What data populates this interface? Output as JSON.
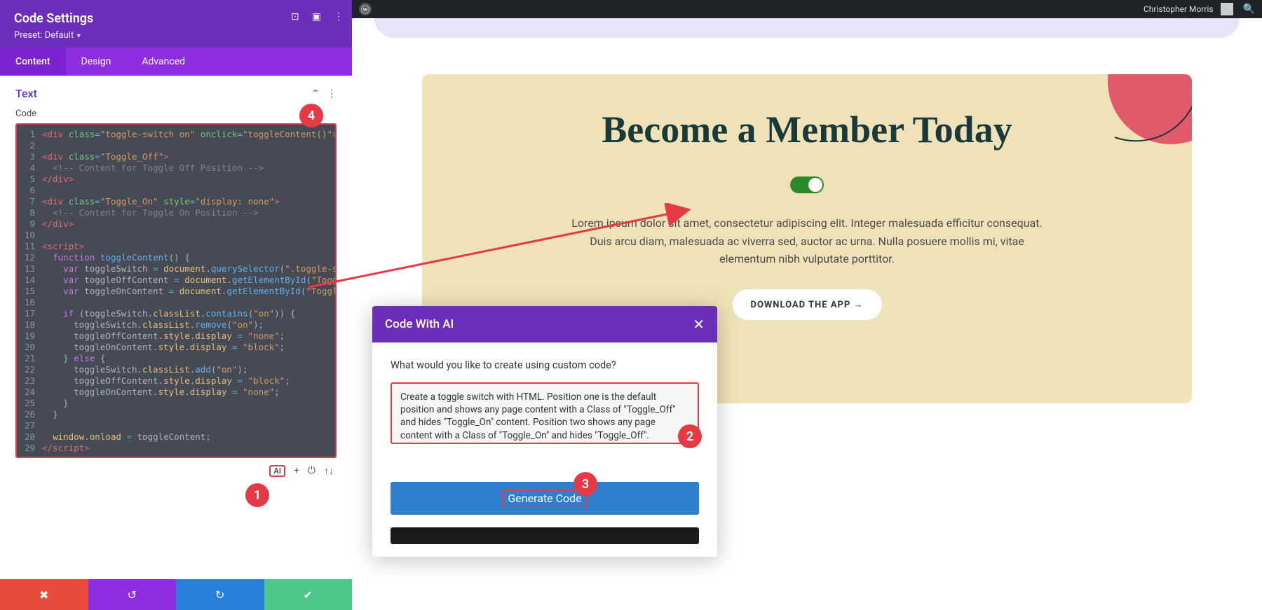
{
  "panel": {
    "title": "Code Settings",
    "preset_prefix": "Preset: ",
    "preset_value": "Default",
    "header_icons": {
      "drag": "drag-icon",
      "responsive": "responsive-icon",
      "more": "more-icon"
    },
    "tabs": [
      {
        "label": "Content",
        "active": true
      },
      {
        "label": "Design",
        "active": false
      },
      {
        "label": "Advanced",
        "active": false
      }
    ],
    "section": {
      "title": "Text",
      "code_label": "Code"
    },
    "editor_tools": {
      "ai": "AI",
      "add": "+",
      "reset": "⟳",
      "expand": "↑↓"
    }
  },
  "code": {
    "lines": [
      {
        "n": 1,
        "html": "<span class='t-tag'>&lt;div</span> <span class='t-attr'>class</span><span class='t-op'>=</span><span class='t-str'>\"toggle-switch on\"</span> <span class='t-attr'>onclick</span><span class='t-op'>=</span><span class='t-str'>\"toggleContent()\"</span><span class='t-tag'>&gt;&lt;/div&gt;</span>"
      },
      {
        "n": 2,
        "html": ""
      },
      {
        "n": 3,
        "html": "<span class='t-tag'>&lt;div</span> <span class='t-attr'>class</span><span class='t-op'>=</span><span class='t-str'>\"Toggle_Off\"</span><span class='t-tag'>&gt;</span>"
      },
      {
        "n": 4,
        "html": "  <span class='t-cm'>&lt;!-- Content for Toggle Off Position --&gt;</span>"
      },
      {
        "n": 5,
        "html": "<span class='t-tag'>&lt;/div&gt;</span>"
      },
      {
        "n": 6,
        "html": ""
      },
      {
        "n": 7,
        "html": "<span class='t-tag'>&lt;div</span> <span class='t-attr'>class</span><span class='t-op'>=</span><span class='t-str'>\"Toggle_On\"</span> <span class='t-attr'>style</span><span class='t-op'>=</span><span class='t-str'>\"display: none\"</span><span class='t-tag'>&gt;</span>"
      },
      {
        "n": 8,
        "html": "  <span class='t-cm'>&lt;!-- Content for Toggle On Position --&gt;</span>"
      },
      {
        "n": 9,
        "html": "<span class='t-tag'>&lt;/div&gt;</span>"
      },
      {
        "n": 10,
        "html": ""
      },
      {
        "n": 11,
        "html": "<span class='t-tag'>&lt;script&gt;</span>"
      },
      {
        "n": 12,
        "html": "  <span class='t-kw'>function</span> <span class='t-fn'>toggleContent</span><span class='t-pl'>() {</span>"
      },
      {
        "n": 13,
        "html": "    <span class='t-kw'>var</span> <span class='t-pl'>toggleSwitch</span> <span class='t-op'>=</span> <span class='t-id'>document</span><span class='t-dot'>.</span><span class='t-fn'>querySelector</span><span class='t-pl'>(</span><span class='t-str'>\".toggle-switch\"</span><span class='t-pl'>);</span>"
      },
      {
        "n": 14,
        "html": "    <span class='t-kw'>var</span> <span class='t-pl'>toggleOffContent</span> <span class='t-op'>=</span> <span class='t-id'>document</span><span class='t-dot'>.</span><span class='t-fn'>getElementById</span><span class='t-pl'>(</span><span class='t-str'>\"Toggle_Off\"</span><span class='t-pl'>);</span>"
      },
      {
        "n": 15,
        "html": "    <span class='t-kw'>var</span> <span class='t-pl'>toggleOnContent</span> <span class='t-op'>=</span> <span class='t-id'>document</span><span class='t-dot'>.</span><span class='t-fn'>getElementById</span><span class='t-pl'>(</span><span class='t-str'>\"Toggle_On\"</span><span class='t-pl'>);</span>"
      },
      {
        "n": 16,
        "html": ""
      },
      {
        "n": 17,
        "html": "    <span class='t-kw'>if</span> <span class='t-pl'>(toggleSwitch</span><span class='t-dot'>.</span><span class='t-id'>classList</span><span class='t-dot'>.</span><span class='t-fn'>contains</span><span class='t-pl'>(</span><span class='t-str'>\"on\"</span><span class='t-pl'>)) {</span>"
      },
      {
        "n": 18,
        "html": "      <span class='t-pl'>toggleSwitch</span><span class='t-dot'>.</span><span class='t-id'>classList</span><span class='t-dot'>.</span><span class='t-fn'>remove</span><span class='t-pl'>(</span><span class='t-str'>\"on\"</span><span class='t-pl'>);</span>"
      },
      {
        "n": 19,
        "html": "      <span class='t-pl'>toggleOffContent</span><span class='t-dot'>.</span><span class='t-id'>style</span><span class='t-dot'>.</span><span class='t-id'>display</span> <span class='t-op'>=</span> <span class='t-str'>\"none\"</span><span class='t-pl'>;</span>"
      },
      {
        "n": 20,
        "html": "      <span class='t-pl'>toggleOnContent</span><span class='t-dot'>.</span><span class='t-id'>style</span><span class='t-dot'>.</span><span class='t-id'>display</span> <span class='t-op'>=</span> <span class='t-str'>\"block\"</span><span class='t-pl'>;</span>"
      },
      {
        "n": 21,
        "html": "    <span class='t-pl'>}</span> <span class='t-kw'>else</span> <span class='t-pl'>{</span>"
      },
      {
        "n": 22,
        "html": "      <span class='t-pl'>toggleSwitch</span><span class='t-dot'>.</span><span class='t-id'>classList</span><span class='t-dot'>.</span><span class='t-fn'>add</span><span class='t-pl'>(</span><span class='t-str'>\"on\"</span><span class='t-pl'>);</span>"
      },
      {
        "n": 23,
        "html": "      <span class='t-pl'>toggleOffContent</span><span class='t-dot'>.</span><span class='t-id'>style</span><span class='t-dot'>.</span><span class='t-id'>display</span> <span class='t-op'>=</span> <span class='t-str'>\"block\"</span><span class='t-pl'>;</span>"
      },
      {
        "n": 24,
        "html": "      <span class='t-pl'>toggleOnContent</span><span class='t-dot'>.</span><span class='t-id'>style</span><span class='t-dot'>.</span><span class='t-id'>display</span> <span class='t-op'>=</span> <span class='t-str'>\"none\"</span><span class='t-pl'>;</span>"
      },
      {
        "n": 25,
        "html": "    <span class='t-pl'>}</span>"
      },
      {
        "n": 26,
        "html": "  <span class='t-pl'>}</span>"
      },
      {
        "n": 27,
        "html": ""
      },
      {
        "n": 28,
        "html": "  <span class='t-id'>window</span><span class='t-dot'>.</span><span class='t-id'>onload</span> <span class='t-op'>=</span> <span class='t-pl'>toggleContent;</span>"
      },
      {
        "n": 29,
        "html": "<span class='t-tag'>&lt;/script&gt;</span>"
      }
    ]
  },
  "wp": {
    "user": "Christopher Morris"
  },
  "hero": {
    "title": "Become a Member Today",
    "paragraph": "Lorem ipsum dolor sit amet, consectetur adipiscing elit. Integer malesuada efficitur consequat. Duis arcu diam, malesuada ac viverra sed, auctor ac urna. Nulla posuere mollis mi, vitae elementum nibh vulputate porttitor.",
    "button": "DOWNLOAD THE APP →"
  },
  "ai": {
    "title": "Code With AI",
    "question": "What would you like to create using custom code?",
    "prompt": "Create a toggle switch with HTML. Position one is the default position and shows any page content with a Class of \"Toggle_Off\" and hides \"Toggle_On\" content. Position two shows any page content with a Class of \"Toggle_On\" and hides \"Toggle_Off\".",
    "generate": "Generate Code"
  },
  "annotations": {
    "b1": "1",
    "b2": "2",
    "b3": "3",
    "b4": "4"
  }
}
